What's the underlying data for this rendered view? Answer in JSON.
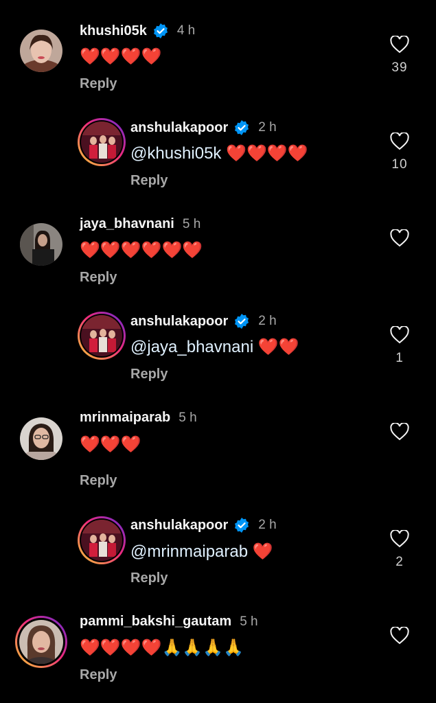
{
  "comments": [
    {
      "user": "khushi05k",
      "verified": true,
      "time": "4 h",
      "text": "❤️❤️❤️❤️",
      "reply": "Reply",
      "likes": "39",
      "avatar": "profile-photo-woman"
    },
    {
      "user": "anshulakapoor",
      "verified": true,
      "time": "2 h",
      "mention": "@khushi05k",
      "text": "❤️❤️❤️❤️",
      "reply": "Reply",
      "likes": "10",
      "avatar": "story-ring-photo"
    },
    {
      "user": "jaya_bhavnani",
      "verified": false,
      "time": "5 h",
      "text": "❤️❤️❤️❤️❤️❤️",
      "reply": "Reply",
      "likes": "",
      "avatar": "profile-photo-woman"
    },
    {
      "user": "anshulakapoor",
      "verified": true,
      "time": "2 h",
      "mention": "@jaya_bhavnani",
      "text": "❤️❤️",
      "reply": "Reply",
      "likes": "1",
      "avatar": "story-ring-photo"
    },
    {
      "user": "mrinmaiparab",
      "verified": false,
      "time": "5 h",
      "text": "❤️❤️❤️",
      "reply": "Reply",
      "likes": "",
      "avatar": "profile-photo-woman"
    },
    {
      "user": "anshulakapoor",
      "verified": true,
      "time": "2 h",
      "mention": "@mrinmaiparab",
      "text": "❤️",
      "reply": "Reply",
      "likes": "2",
      "avatar": "story-ring-photo"
    },
    {
      "user": "pammi_bakshi_gautam",
      "verified": false,
      "time": "5 h",
      "text": "❤️❤️❤️❤️🙏🙏🙏🙏",
      "reply": "Reply",
      "likes": "",
      "avatar": "story-ring-photo"
    }
  ],
  "colors": {
    "background": "#000000",
    "text": "#f5f5f5",
    "muted": "#a8a8a8",
    "verified": "#0095f6",
    "heart_emoji": "#ed2c3b"
  }
}
